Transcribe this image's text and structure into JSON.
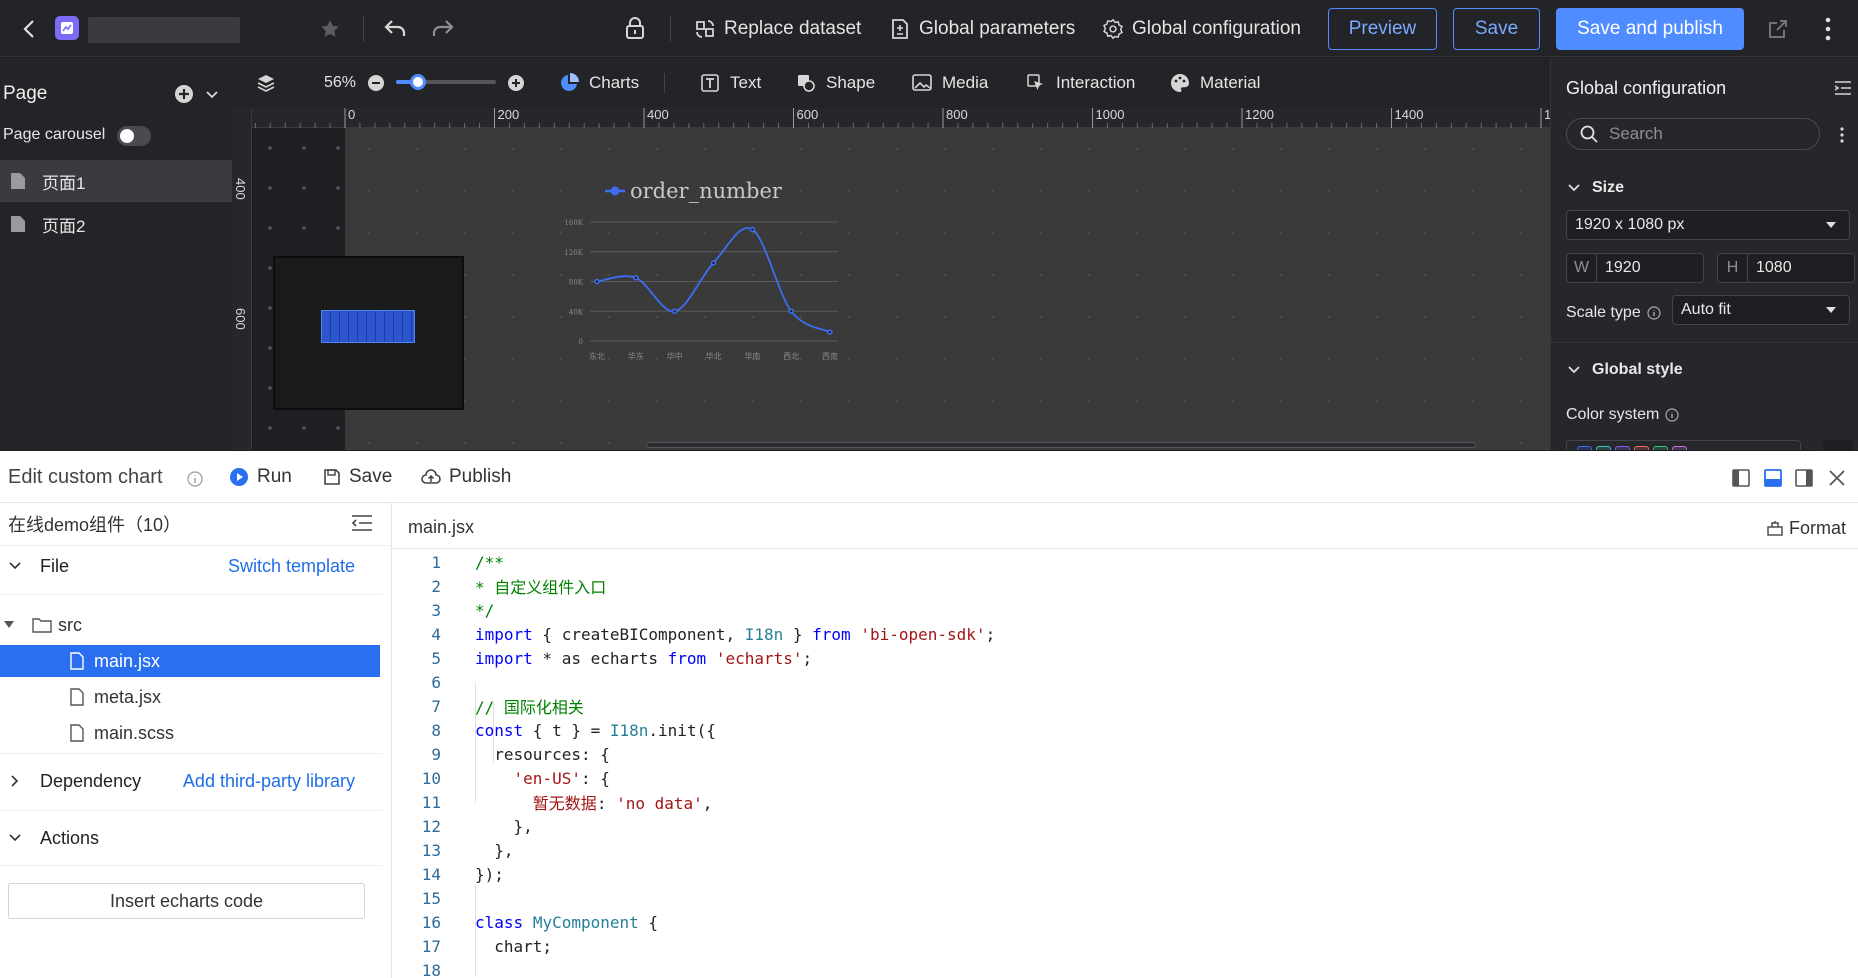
{
  "topbar": {
    "title_placeholder": "",
    "replace_dataset": "Replace dataset",
    "global_parameters": "Global parameters",
    "global_configuration": "Global configuration",
    "preview": "Preview",
    "save": "Save",
    "save_publish": "Save and publish"
  },
  "page_panel": {
    "title": "Page",
    "carousel_label": "Page carousel",
    "pages": [
      {
        "label": "页面1"
      },
      {
        "label": "页面2"
      }
    ]
  },
  "toolbar": {
    "zoom": "56%",
    "zoom_level": 0.56,
    "charts": "Charts",
    "text": "Text",
    "shape": "Shape",
    "media": "Media",
    "interaction": "Interaction",
    "material": "Material"
  },
  "ruler": {
    "h_ticks": [
      "0",
      "200",
      "400",
      "600",
      "800",
      "1000",
      "1200",
      "1400",
      "1"
    ],
    "v_ticks": [
      "400",
      "600"
    ]
  },
  "chart_data": {
    "type": "line",
    "categories": [
      "东北",
      "华东",
      "华中",
      "华北",
      "华南",
      "西北",
      "西南"
    ],
    "series": [
      {
        "name": "order_number",
        "values": [
          80000,
          85000,
          40000,
          105000,
          150000,
          40000,
          12000
        ]
      }
    ],
    "yticks": [
      "160K",
      "120K",
      "80K",
      "40K",
      "0"
    ],
    "ylim": [
      0,
      160000
    ],
    "legend": "top-left",
    "grid": true,
    "color": "#3d6ef2"
  },
  "right_panel": {
    "title": "Global configuration",
    "search_placeholder": "Search",
    "size_section": "Size",
    "size_select": "1920 x 1080 px",
    "w_label": "W",
    "w_value": "1920",
    "h_label": "H",
    "h_value": "1080",
    "scale_label": "Scale type",
    "scale_value": "Auto fit",
    "global_style": "Global style",
    "color_system": "Color system",
    "swatches": [
      "#3d6ef2",
      "#3ec6c0",
      "#8a5cf6",
      "#f06b5a",
      "#3fbf7f",
      "#c86ee0"
    ]
  },
  "editor": {
    "title": "Edit custom chart",
    "run": "Run",
    "save": "Save",
    "publish": "Publish",
    "project": "在线demo组件（10）",
    "file_section": "File",
    "switch_template": "Switch template",
    "folder": "src",
    "files": [
      "main.jsx",
      "meta.jsx",
      "main.scss"
    ],
    "dependency": "Dependency",
    "add_library": "Add third-party library",
    "actions": "Actions",
    "insert_echarts": "Insert echarts code",
    "tab": "main.jsx",
    "format": "Format"
  },
  "code_lines": [
    [
      [
        "cmt",
        "/**"
      ]
    ],
    [
      [
        "cmt",
        "* 自定义组件入口"
      ]
    ],
    [
      [
        "cmt",
        "*/"
      ]
    ],
    [
      [
        "kw",
        "import"
      ],
      [
        "fn",
        " { createBIComponent, "
      ],
      [
        "cls",
        "I18n"
      ],
      [
        "fn",
        " } "
      ],
      [
        "kw",
        "from"
      ],
      [
        "fn",
        " "
      ],
      [
        "str",
        "'bi-open-sdk'"
      ],
      [
        "fn",
        ";"
      ]
    ],
    [
      [
        "kw",
        "import"
      ],
      [
        "fn",
        " * as echarts "
      ],
      [
        "kw",
        "from"
      ],
      [
        "fn",
        " "
      ],
      [
        "str",
        "'echarts'"
      ],
      [
        "fn",
        ";"
      ]
    ],
    [],
    [
      [
        "cmt",
        "// 国际化相关"
      ]
    ],
    [
      [
        "kw",
        "const"
      ],
      [
        "fn",
        " { t } = "
      ],
      [
        "cls",
        "I18n"
      ],
      [
        "fn",
        ".init({"
      ]
    ],
    [
      [
        "fn",
        "  resources: {"
      ]
    ],
    [
      [
        "fn",
        "    "
      ],
      [
        "str",
        "'en-US'"
      ],
      [
        "fn",
        ": {"
      ]
    ],
    [
      [
        "fn",
        "      "
      ],
      [
        "str",
        "暂无数据"
      ],
      [
        "fn",
        ": "
      ],
      [
        "str",
        "'no data'"
      ],
      [
        "fn",
        ","
      ]
    ],
    [
      [
        "fn",
        "    },"
      ]
    ],
    [
      [
        "fn",
        "  },"
      ]
    ],
    [
      [
        "fn",
        "});"
      ]
    ],
    [],
    [
      [
        "kw",
        "class"
      ],
      [
        "fn",
        " "
      ],
      [
        "cls",
        "MyComponent"
      ],
      [
        "fn",
        " {"
      ]
    ],
    [
      [
        "fn",
        "  chart;"
      ]
    ],
    []
  ]
}
